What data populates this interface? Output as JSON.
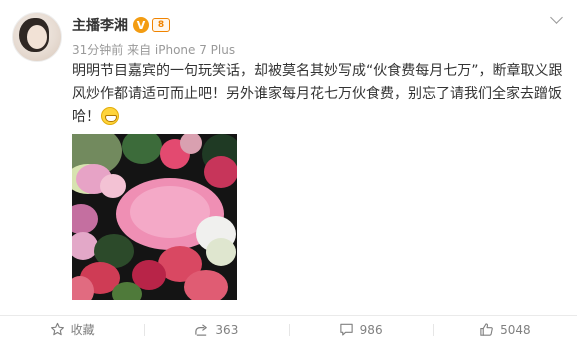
{
  "post": {
    "username": "主播李湘",
    "verified_mark": "V",
    "level_mark": "8",
    "meta": "31分钟前 来自 iPhone 7 Plus",
    "text": "明明节目嘉宾的一句玩笑话，却被莫名其妙写成“伙食费每月七万”，断章取义跟风炒作都请适可而止吧！另外谁家每月花七万伙食费，别忘了请我们全家去蹭饭哈！"
  },
  "actions": {
    "favorite_label": "收藏",
    "repost_count": "363",
    "comment_count": "986",
    "like_count": "5048"
  },
  "icons": {
    "favorite": "star-icon",
    "repost": "share-icon",
    "comment": "comment-icon",
    "like": "thumbs-up-icon"
  },
  "colors": {
    "verified_badge": "#f39c12",
    "level_badge": "#f08300",
    "meta_text": "#999999",
    "action_text": "#808080"
  }
}
